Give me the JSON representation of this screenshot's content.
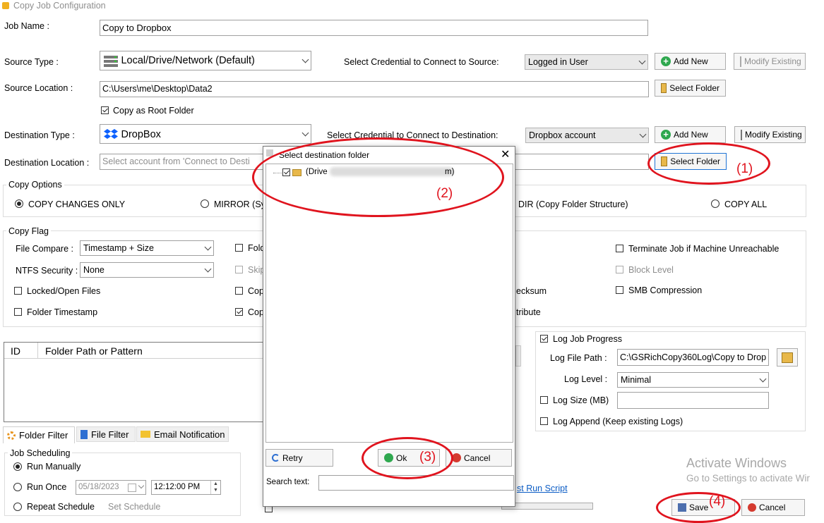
{
  "window": {
    "title": "Copy Job Configuration"
  },
  "job": {
    "name_label": "Job Name :",
    "name_value": "Copy to Dropbox"
  },
  "source": {
    "type_label": "Source Type :",
    "type_value": "Local/Drive/Network (Default)",
    "credential_label": "Select Credential to Connect to Source:",
    "credential_value": "Logged in User",
    "add_new": "Add New",
    "modify_existing": "Modify Existing",
    "location_label": "Source Location :",
    "location_value": "C:\\Users\\me\\Desktop\\Data2",
    "select_folder": "Select Folder",
    "copy_root_label": "Copy as Root Folder"
  },
  "destination": {
    "type_label": "Destination Type :",
    "type_value": "DropBox",
    "credential_label": "Select Credential to Connect to Destination:",
    "credential_value": "Dropbox account",
    "add_new": "Add New",
    "modify_existing": "Modify Existing",
    "location_label": "Destination Location :",
    "location_placeholder": "Select account from 'Connect to Desti",
    "select_folder": "Select Folder"
  },
  "copy_options": {
    "title": "Copy Options",
    "opt1": "COPY CHANGES ONLY",
    "opt2": "MIRROR (Sy",
    "opt3": "DIR (Copy Folder Structure)",
    "opt4": "COPY ALL"
  },
  "copy_flag": {
    "title": "Copy Flag",
    "file_compare_label": "File Compare :",
    "file_compare_value": "Timestamp + Size",
    "ntfs_label": "NTFS Security :",
    "ntfs_value": "None",
    "locked_files": "Locked/Open Files",
    "folder_timestamp": "Folder Timestamp",
    "mid1": "Fold",
    "mid2": "Skip",
    "mid3": "Cop",
    "mid4": "Cop",
    "checksum": "ecksum",
    "attribute": "tribute",
    "terminate": "Terminate Job if Machine Unreachable",
    "block_level": "Block Level",
    "smb": "SMB Compression"
  },
  "filter_table": {
    "col_id": "ID",
    "col_path": "Folder Path or Pattern"
  },
  "tabs": {
    "folder_filter": "Folder Filter",
    "file_filter": "File Filter",
    "email": "Email Notification"
  },
  "scheduling": {
    "title": "Job Scheduling",
    "run_manually": "Run Manually",
    "run_once": "Run Once",
    "date_value": "05/18/2023",
    "time_value": "12:12:00 PM",
    "repeat": "Repeat Schedule",
    "set_schedule": "Set Schedule"
  },
  "log": {
    "progress_label": "Log Job Progress",
    "file_path_label": "Log File Path :",
    "file_path_value": "C:\\GSRichCopy360Log\\Copy to Drop",
    "level_label": "Log Level :",
    "level_value": "Minimal",
    "size_label": "Log Size (MB)",
    "append_label": "Log Append (Keep existing Logs)"
  },
  "post_run": "st Run Script",
  "footer": {
    "save": "Save",
    "cancel": "Cancel"
  },
  "watermark": {
    "line1": "Activate Windows",
    "line2": "Go to Settings to activate Wir"
  },
  "dialog": {
    "title": "Select destination folder",
    "tree_item": "(Drive",
    "tree_item_suffix": "m)",
    "retry": "Retry",
    "ok": "Ok",
    "cancel": "Cancel",
    "search_label": "Search text:"
  },
  "annotations": {
    "a1": "(1)",
    "a2": "(2)",
    "a3": "(3)",
    "a4": "(4)"
  },
  "colors": {
    "annotation": "#e0141e",
    "focus": "#1f74d6",
    "folder_icon": "#e8b84a",
    "dropbox": "#0d61fe"
  }
}
